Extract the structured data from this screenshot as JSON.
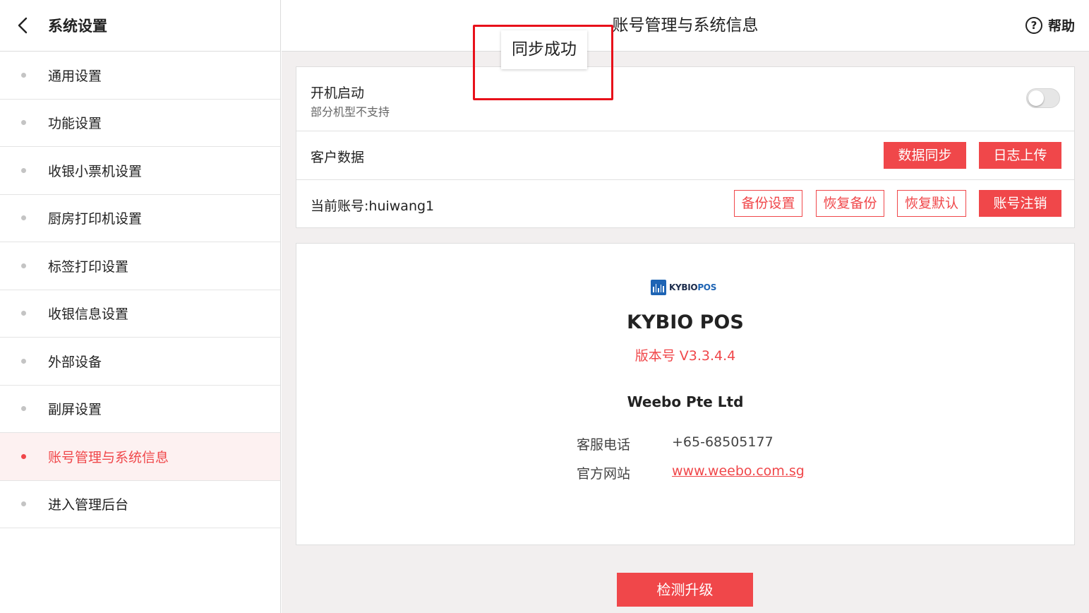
{
  "sidebar": {
    "title": "系统设置",
    "items": [
      {
        "label": "通用设置"
      },
      {
        "label": "功能设置"
      },
      {
        "label": "收银小票机设置"
      },
      {
        "label": "厨房打印机设置"
      },
      {
        "label": "标签打印设置"
      },
      {
        "label": "收银信息设置"
      },
      {
        "label": "外部设备"
      },
      {
        "label": "副屏设置"
      },
      {
        "label": "账号管理与系统信息",
        "active": true
      },
      {
        "label": "进入管理后台"
      }
    ]
  },
  "header": {
    "title": "账号管理与系统信息",
    "help_label": "帮助",
    "help_icon": "question-circle-icon"
  },
  "settings": {
    "boot": {
      "title": "开机启动",
      "subtitle": "部分机型不支持",
      "enabled": false
    },
    "customer_data": {
      "title": "客户数据",
      "sync_button": "数据同步",
      "log_upload_button": "日志上传"
    },
    "account": {
      "label": "当前账号:huiwang1",
      "backup_settings_button": "备份设置",
      "restore_backup_button": "恢复备份",
      "restore_default_button": "恢复默认",
      "logout_button": "账号注销"
    }
  },
  "about": {
    "logo_text": "KYBIO",
    "logo_text_accent": "POS",
    "app_name": "KYBIO POS",
    "version": "版本号 V3.3.4.4",
    "company": "Weebo Pte Ltd",
    "phone_label": "客服电话",
    "phone": "+65-68505177",
    "website_label": "官方网站",
    "website": "www.weebo.com.sg"
  },
  "upgrade_button": "检测升级",
  "toast": {
    "message": "同步成功"
  },
  "colors": {
    "accent": "#f0474a",
    "highlight": "#e8101a",
    "logo_blue": "#1e64b4"
  }
}
